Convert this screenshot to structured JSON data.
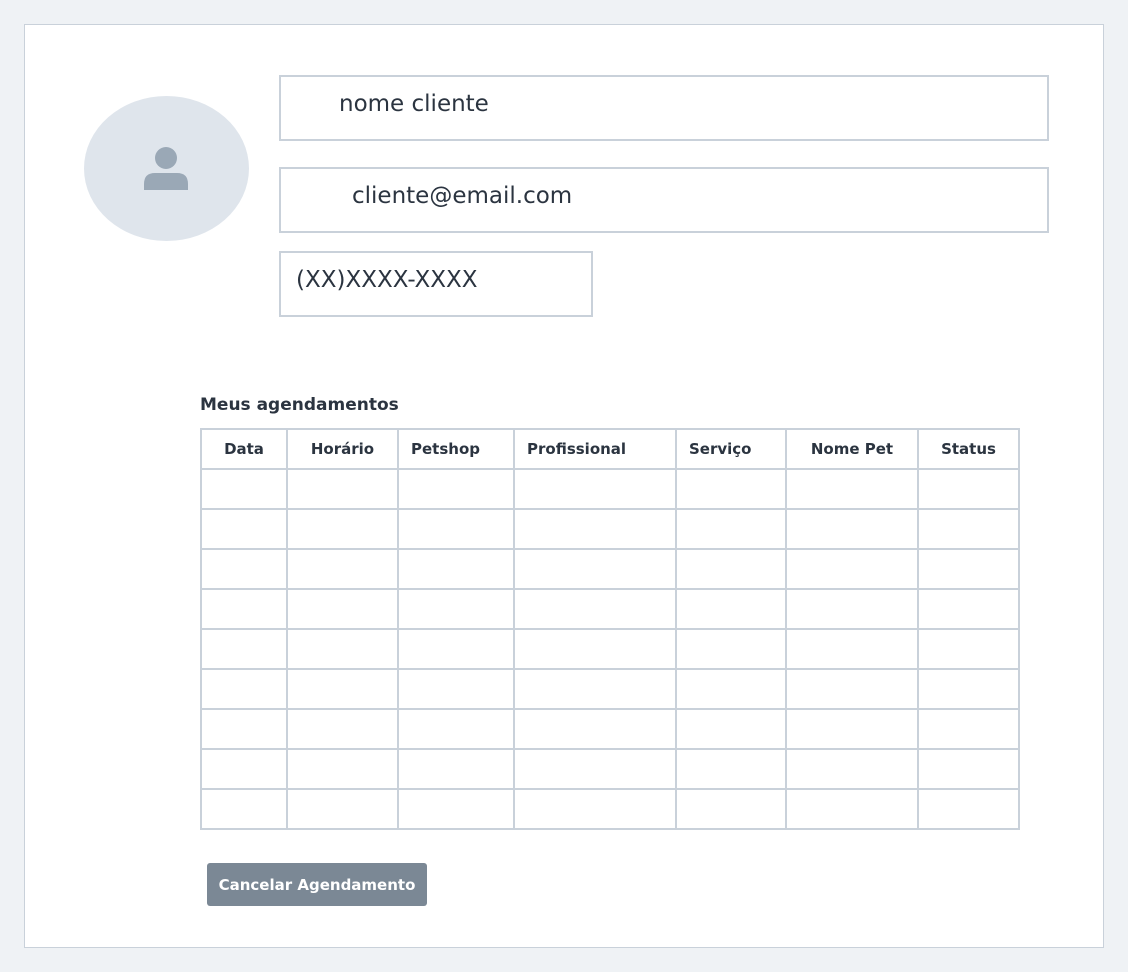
{
  "profile": {
    "name": "nome cliente",
    "email": "cliente@email.com",
    "phone": "(XX)XXXX-XXXX"
  },
  "appointments": {
    "title": "Meus agendamentos",
    "columns": [
      "Data",
      "Horário",
      "Petshop",
      "Profissional",
      "Serviço",
      "Nome Pet",
      "Status"
    ],
    "rows": [
      [
        "",
        "",
        "",
        "",
        "",
        "",
        ""
      ],
      [
        "",
        "",
        "",
        "",
        "",
        "",
        ""
      ],
      [
        "",
        "",
        "",
        "",
        "",
        "",
        ""
      ],
      [
        "",
        "",
        "",
        "",
        "",
        "",
        ""
      ],
      [
        "",
        "",
        "",
        "",
        "",
        "",
        ""
      ],
      [
        "",
        "",
        "",
        "",
        "",
        "",
        ""
      ],
      [
        "",
        "",
        "",
        "",
        "",
        "",
        ""
      ],
      [
        "",
        "",
        "",
        "",
        "",
        "",
        ""
      ],
      [
        "",
        "",
        "",
        "",
        "",
        "",
        ""
      ]
    ]
  },
  "actions": {
    "cancel_label": "Cancelar Agendamento"
  },
  "icons": {
    "avatar": "user-icon"
  },
  "colors": {
    "background": "#eff2f5",
    "border": "#c9d1da",
    "avatar_bg": "#dfe5ec",
    "avatar_icon": "#9aa8b6",
    "button_bg": "#7b8895",
    "text": "#2b3440"
  }
}
